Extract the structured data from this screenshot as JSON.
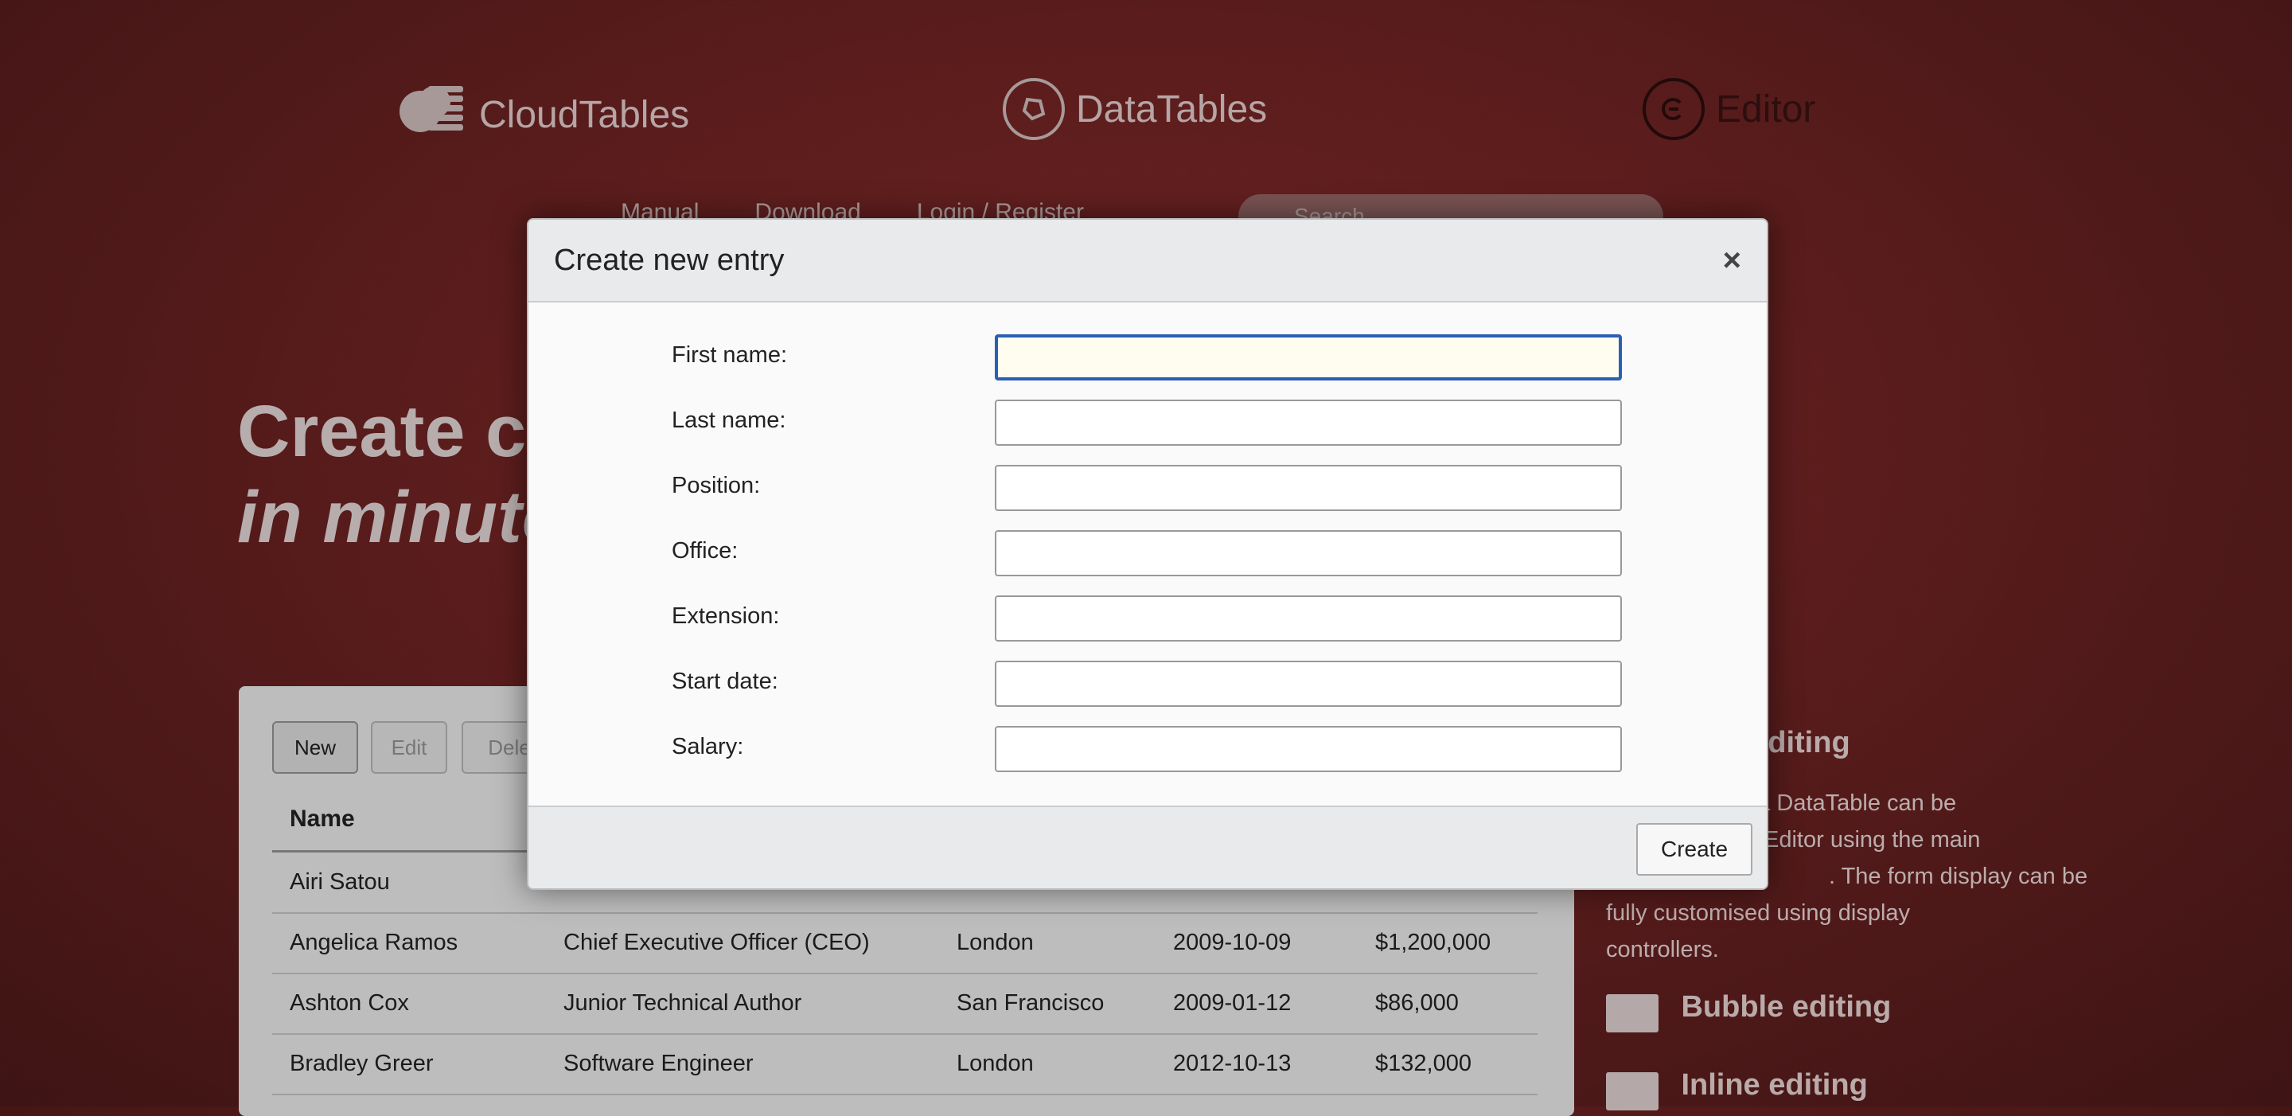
{
  "brands": [
    {
      "name": "CloudTables",
      "icon": "cloud-icon"
    },
    {
      "name": "DataTables",
      "icon": "datatables-logo-icon"
    },
    {
      "name": "Editor",
      "icon": "editor-logo-icon"
    }
  ],
  "nav": {
    "manual": "Manual",
    "download": "Download",
    "login": "Login / Register",
    "search_placeholder": "Search"
  },
  "hero": {
    "line1": "Create cu",
    "line2": "in minute"
  },
  "toolbar": {
    "new_label": "New",
    "edit_label": "Edit",
    "delete_label": "Dele"
  },
  "table": {
    "header_name": "Name",
    "rows": [
      {
        "name": "Airi Satou",
        "position": "",
        "office": "",
        "start": "",
        "salary": ""
      },
      {
        "name": "Angelica Ramos",
        "position": "Chief Executive Officer (CEO)",
        "office": "London",
        "start": "2009-10-09",
        "salary": "$1,200,000"
      },
      {
        "name": "Ashton Cox",
        "position": "Junior Technical Author",
        "office": "San Francisco",
        "start": "2009-01-12",
        "salary": "$86,000"
      },
      {
        "name": "Bradley Greer",
        "position": "Software Engineer",
        "office": "London",
        "start": "2012-10-13",
        "salary": "$132,000"
      }
    ]
  },
  "side": {
    "row_editing_title": "w editing",
    "row_editing_text_1": "n a DataTable can be",
    "row_editing_text_2": "Editor using the main",
    "row_editing_text_3": ". The form display can be",
    "row_editing_text_4": "fully customised using display",
    "row_editing_text_5": "controllers.",
    "bubble_title": "Bubble editing",
    "inline_title": "Inline editing"
  },
  "modal": {
    "title": "Create new entry",
    "close": "×",
    "fields": [
      {
        "label": "First name:",
        "value": ""
      },
      {
        "label": "Last name:",
        "value": ""
      },
      {
        "label": "Position:",
        "value": ""
      },
      {
        "label": "Office:",
        "value": ""
      },
      {
        "label": "Extension:",
        "value": ""
      },
      {
        "label": "Start date:",
        "value": ""
      },
      {
        "label": "Salary:",
        "value": ""
      }
    ],
    "submit_label": "Create"
  },
  "colors": {
    "background": "#5a1c1c",
    "focus_border": "#2b5fb3"
  }
}
